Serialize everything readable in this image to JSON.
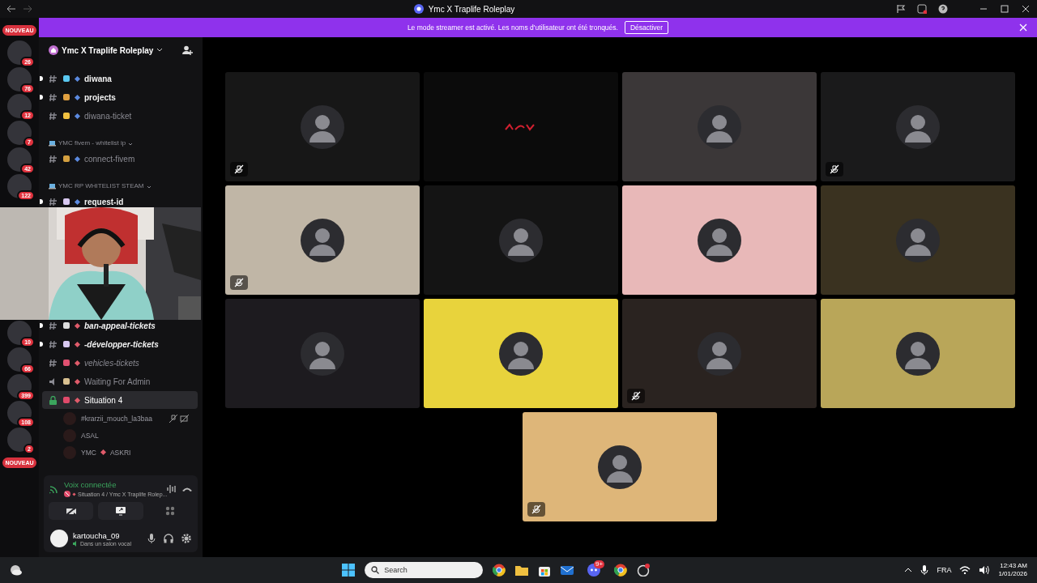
{
  "window": {
    "title": "Ymc X Traplife Roleplay"
  },
  "banner": {
    "text": "Le mode streamer est activé. Les noms d'utilisateur ont été tronqués.",
    "button": "Désactiver"
  },
  "servers_top": [
    {
      "badge": "NOUVEAU",
      "kind": "new"
    },
    {
      "badge": "26",
      "kind": "count"
    },
    {
      "badge": "76",
      "kind": "count"
    },
    {
      "badge": "12",
      "kind": "count"
    },
    {
      "badge": "7",
      "kind": "count"
    },
    {
      "badge": "42",
      "kind": "count"
    },
    {
      "badge": "122",
      "kind": "count"
    }
  ],
  "servers_bottom": [
    {
      "badge": "10",
      "kind": "count"
    },
    {
      "badge": "66",
      "kind": "count"
    },
    {
      "badge": "399",
      "kind": "count"
    },
    {
      "badge": "108",
      "kind": "count"
    },
    {
      "badge": "2",
      "kind": "count"
    },
    {
      "badge": "NOUVEAU",
      "kind": "new"
    }
  ],
  "server": {
    "name": "Ymc X Traplife Roleplay"
  },
  "channels_top": [
    {
      "kind": "text",
      "label": "diwana",
      "unread": true,
      "italic": false,
      "color": "#5b8ae0"
    },
    {
      "kind": "text",
      "label": "projects",
      "unread": true,
      "italic": false,
      "color": "#5b8ae0"
    },
    {
      "kind": "text",
      "label": "diwana-ticket",
      "unread": false,
      "italic": false,
      "color": "#5b8ae0"
    },
    {
      "kind": "category",
      "label": "YMC fivem - whitelist ip"
    },
    {
      "kind": "text",
      "label": "connect-fivem",
      "unread": false,
      "italic": false,
      "color": "#5b8ae0"
    },
    {
      "kind": "category",
      "label": "YMC RP WHITELIST STEAM"
    },
    {
      "kind": "text",
      "label": "request-id",
      "unread": true,
      "italic": false,
      "color": "#5b8ae0"
    }
  ],
  "channels_bottom": [
    {
      "kind": "text",
      "label": "ban-appeal-tickets",
      "unread": true,
      "italic": true,
      "selected": false,
      "color": "#e05b6a"
    },
    {
      "kind": "text",
      "label": "-développer-tickets",
      "unread": true,
      "italic": true,
      "selected": false,
      "color": "#e05b6a"
    },
    {
      "kind": "text",
      "label": "vehicles-tickets",
      "unread": false,
      "italic": true,
      "selected": false,
      "color": "#e05b6a"
    },
    {
      "kind": "voice",
      "label": "Waiting For Admin",
      "unread": false,
      "italic": false,
      "selected": false,
      "color": "#e05b6a"
    },
    {
      "kind": "locked-voice",
      "label": "Situation 4",
      "unread": false,
      "italic": false,
      "selected": true,
      "color": "#e05b6a"
    }
  ],
  "voice_users": [
    {
      "name": "#krarzii_mouch_la3baa",
      "muted": true
    },
    {
      "name": "ASAL",
      "muted": false
    },
    {
      "name": "YMC",
      "tag": "ASKRI",
      "muted": false
    }
  ],
  "voice_panel": {
    "status": "Voix connectée",
    "channel": "Situation 4 / Ymc X Traplife Rolep..."
  },
  "user": {
    "name": "kartoucha_09",
    "status": "Dans un salon vocal"
  },
  "tiles": [
    {
      "kind": "avatar",
      "color": "#171717",
      "muted": true
    },
    {
      "kind": "logo",
      "color": "#0b0b0b",
      "muted": false
    },
    {
      "kind": "avatar",
      "color": "#3b3738",
      "muted": false
    },
    {
      "kind": "avatar",
      "color": "#1a1a1b",
      "muted": true
    },
    {
      "kind": "avatar",
      "color": "#c0b6a6",
      "muted": true
    },
    {
      "kind": "avatar",
      "color": "#141414",
      "muted": false
    },
    {
      "kind": "avatar",
      "color": "#e8b8b8",
      "muted": false
    },
    {
      "kind": "avatar",
      "color": "#3a3220",
      "muted": false
    },
    {
      "kind": "avatar",
      "color": "#1d1b1f",
      "muted": false
    },
    {
      "kind": "avatar",
      "color": "#e8d33c",
      "muted": false
    },
    {
      "kind": "avatar",
      "color": "#2a2320",
      "muted": true
    },
    {
      "kind": "avatar",
      "color": "#b9a659",
      "muted": false
    },
    {
      "kind": "avatar",
      "color": "#deb679",
      "muted": true
    }
  ],
  "taskbar": {
    "search": "Search",
    "discord_badge": "9+",
    "language": "FRA",
    "time": "12:43 AM",
    "date": "1/01/2026"
  }
}
